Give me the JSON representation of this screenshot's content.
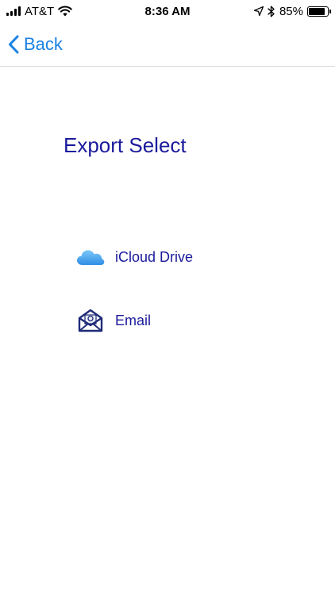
{
  "status_bar": {
    "carrier": "AT&T",
    "time": "8:36 AM",
    "battery_percent": "85%",
    "battery_level": 0.85,
    "icons": [
      "signal-icon",
      "wifi-icon",
      "location-icon",
      "bluetooth-icon",
      "battery-icon"
    ]
  },
  "nav": {
    "back_label": "Back",
    "accent_color": "#1a82e3"
  },
  "main": {
    "title": "Export Select",
    "title_color": "#1a1a9c",
    "options": [
      {
        "label": "iCloud Drive",
        "icon": "icloud-icon"
      },
      {
        "label": "Email",
        "icon": "envelope-icon"
      }
    ]
  }
}
